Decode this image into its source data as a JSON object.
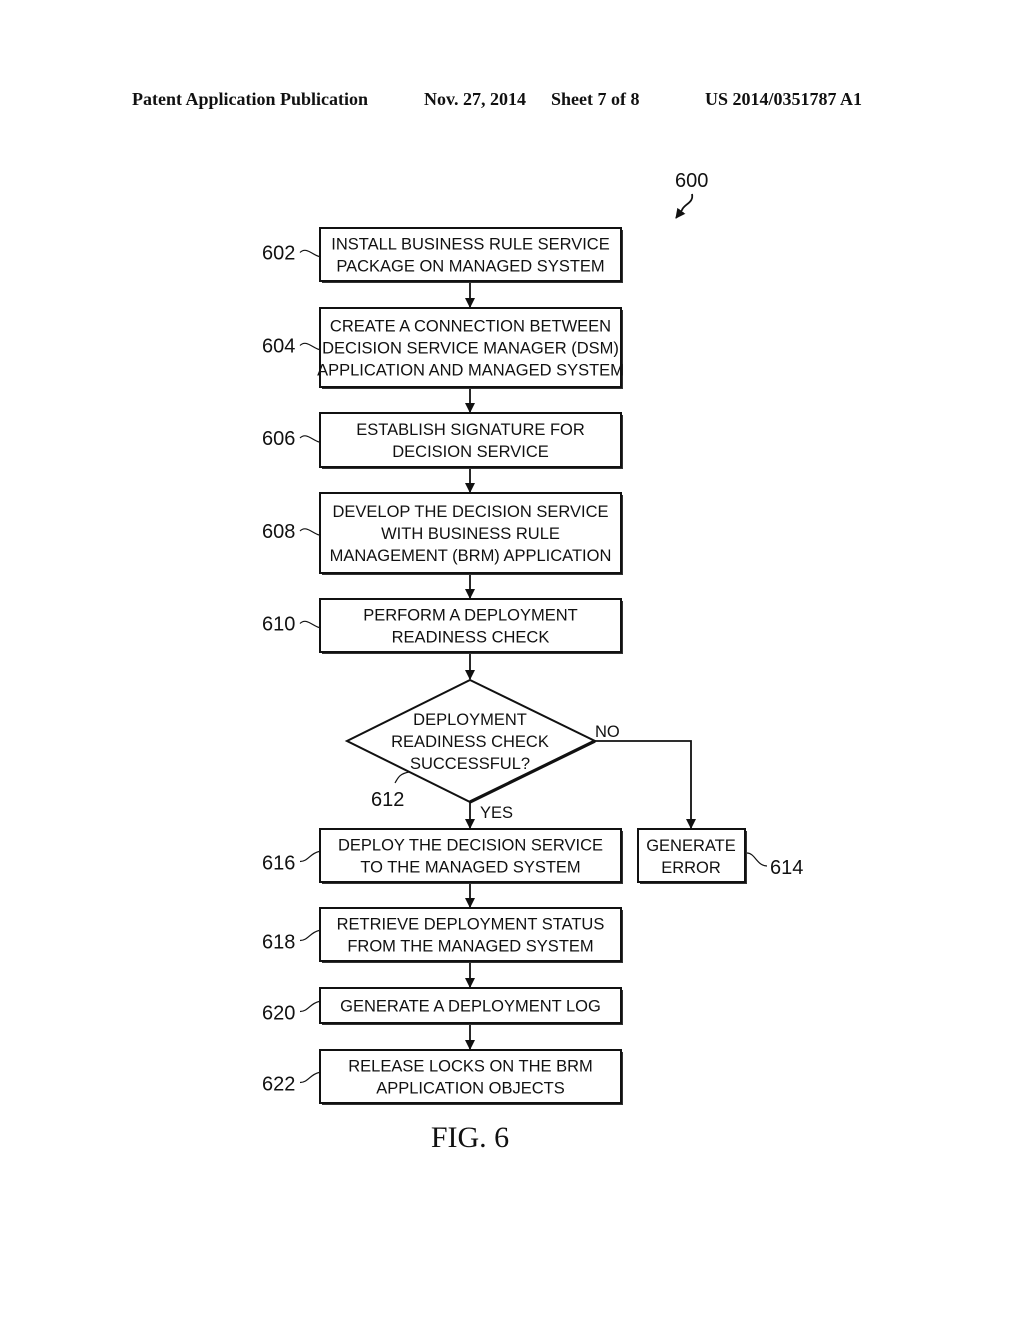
{
  "header": {
    "publication_type": "Patent Application Publication",
    "date": "Nov. 27, 2014",
    "sheet": "Sheet 7 of 8",
    "publication_number": "US 2014/0351787 A1"
  },
  "figure": {
    "reference": "600",
    "caption": "FIG. 6"
  },
  "steps": [
    {
      "ref": "602",
      "lines": [
        "INSTALL BUSINESS RULE SERVICE",
        "PACKAGE ON MANAGED SYSTEM"
      ]
    },
    {
      "ref": "604",
      "lines": [
        "CREATE A CONNECTION BETWEEN",
        "DECISION SERVICE MANAGER (DSM)",
        "APPLICATION AND MANAGED SYSTEM"
      ]
    },
    {
      "ref": "606",
      "lines": [
        "ESTABLISH SIGNATURE FOR",
        "DECISION SERVICE"
      ]
    },
    {
      "ref": "608",
      "lines": [
        "DEVELOP THE DECISION SERVICE",
        "WITH BUSINESS RULE",
        "MANAGEMENT (BRM) APPLICATION"
      ]
    },
    {
      "ref": "610",
      "lines": [
        "PERFORM A DEPLOYMENT",
        "READINESS CHECK"
      ]
    },
    {
      "ref": "616",
      "lines": [
        "DEPLOY THE DECISION SERVICE",
        "TO THE MANAGED SYSTEM"
      ]
    },
    {
      "ref": "618",
      "lines": [
        "RETRIEVE DEPLOYMENT STATUS",
        "FROM THE MANAGED SYSTEM"
      ]
    },
    {
      "ref": "620",
      "lines": [
        "GENERATE A DEPLOYMENT LOG"
      ]
    },
    {
      "ref": "622",
      "lines": [
        "RELEASE LOCKS ON THE BRM",
        "APPLICATION OBJECTS"
      ]
    }
  ],
  "decision": {
    "ref": "612",
    "lines": [
      "DEPLOYMENT",
      "READINESS CHECK",
      "SUCCESSFUL?"
    ],
    "yes_label": "YES",
    "no_label": "NO"
  },
  "error_step": {
    "ref": "614",
    "lines": [
      "GENERATE",
      "ERROR"
    ]
  }
}
